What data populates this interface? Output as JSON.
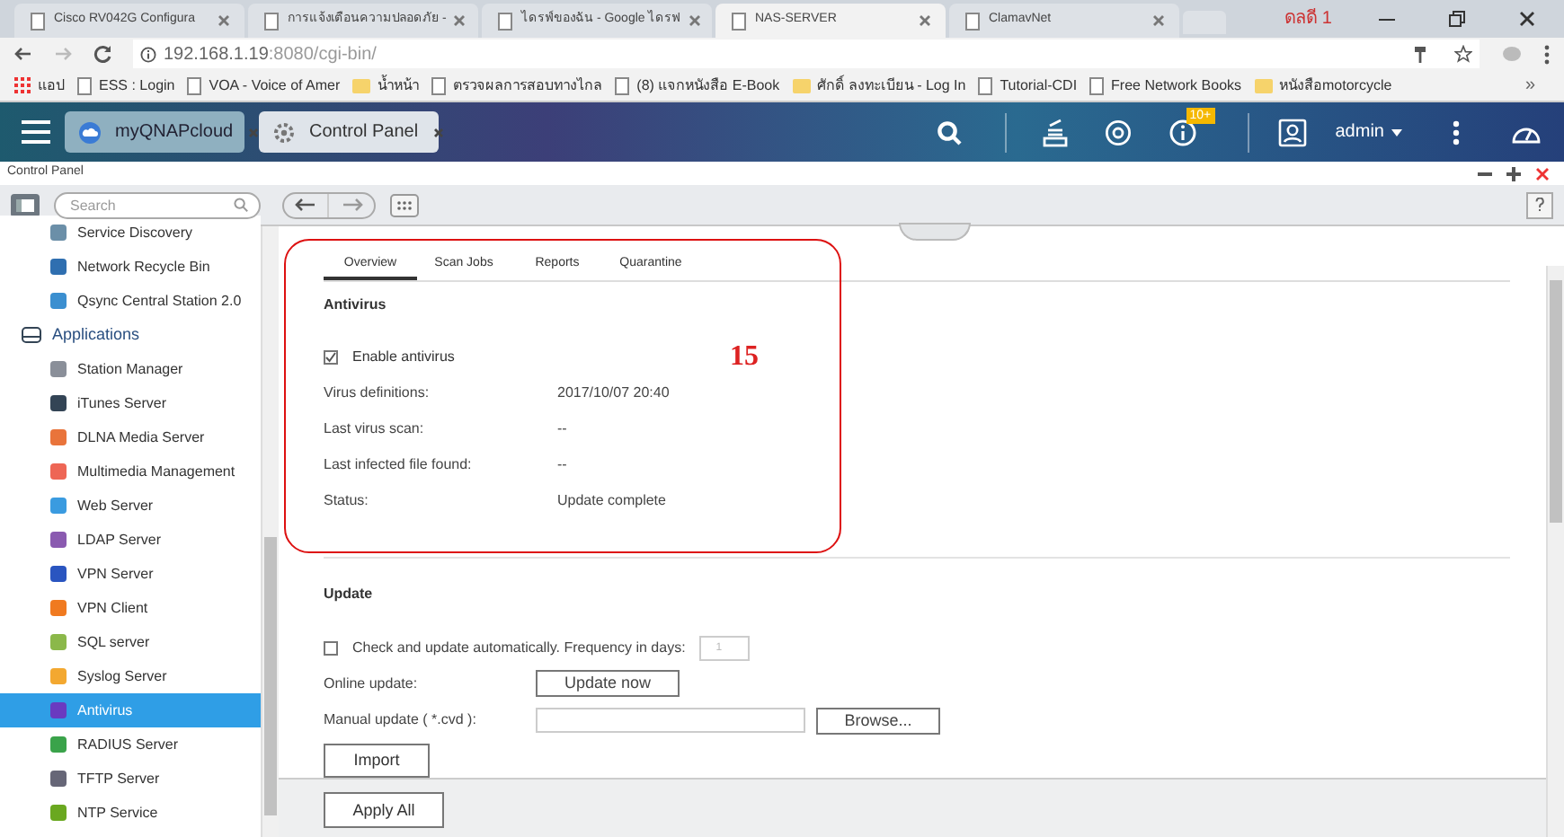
{
  "browser": {
    "tabs": [
      {
        "title": "Cisco RV042G Configura",
        "selected": false
      },
      {
        "title": "การแจ้งเตือนความปลอดภัย -",
        "selected": false
      },
      {
        "title": "ไดรฟ์ของฉัน - Google ไดรฟ",
        "selected": false
      },
      {
        "title": "NAS-SERVER",
        "selected": true
      },
      {
        "title": "ClamavNet",
        "selected": false
      }
    ],
    "profile": "ดลดี 1",
    "url_host": "192.168.1.19",
    "url_rest": ":8080/cgi-bin/",
    "bookmarks": [
      "แอป",
      "ESS : Login",
      "VOA - Voice of Amer",
      "น้ำหน้า",
      "ตรวจผลการสอบทางไกล",
      "(8) แจกหนังสือ E-Book",
      "ศักดิ์ ลงทะเบียน - Log In",
      "Tutorial-CDI",
      "Free Network Books",
      "หนังสือmotorcycle"
    ],
    "more": "»"
  },
  "qnap": {
    "tabs": [
      {
        "title": "myQNAPcloud",
        "selected": false
      },
      {
        "title": "Control Panel",
        "selected": true
      }
    ],
    "badge": "10+",
    "user": "admin"
  },
  "window": {
    "title": "Control Panel",
    "search": {
      "placeholder": "Search"
    }
  },
  "sidebar": {
    "items": [
      {
        "label": "Service Discovery",
        "kind": "item",
        "selected": false
      },
      {
        "label": "Network Recycle Bin",
        "kind": "item",
        "selected": false
      },
      {
        "label": "Qsync Central Station 2.0",
        "kind": "item",
        "selected": false
      },
      {
        "label": "Applications",
        "kind": "group",
        "selected": false
      },
      {
        "label": "Station Manager",
        "kind": "item",
        "selected": false
      },
      {
        "label": "iTunes Server",
        "kind": "item",
        "selected": false
      },
      {
        "label": "DLNA Media Server",
        "kind": "item",
        "selected": false
      },
      {
        "label": "Multimedia Management",
        "kind": "item",
        "selected": false
      },
      {
        "label": "Web Server",
        "kind": "item",
        "selected": false
      },
      {
        "label": "LDAP Server",
        "kind": "item",
        "selected": false
      },
      {
        "label": "VPN Server",
        "kind": "item",
        "selected": false
      },
      {
        "label": "VPN Client",
        "kind": "item",
        "selected": false
      },
      {
        "label": "SQL server",
        "kind": "item",
        "selected": false
      },
      {
        "label": "Syslog Server",
        "kind": "item",
        "selected": false
      },
      {
        "label": "Antivirus",
        "kind": "item",
        "selected": true
      },
      {
        "label": "RADIUS Server",
        "kind": "item",
        "selected": false
      },
      {
        "label": "TFTP Server",
        "kind": "item",
        "selected": false
      },
      {
        "label": "NTP Service",
        "kind": "item",
        "selected": false
      }
    ]
  },
  "content": {
    "tabs": [
      {
        "label": "Overview",
        "selected": true
      },
      {
        "label": "Scan Jobs",
        "selected": false
      },
      {
        "label": "Reports",
        "selected": false
      },
      {
        "label": "Quarantine",
        "selected": false
      }
    ],
    "antivirus": {
      "heading": "Antivirus",
      "enable": {
        "label": "Enable antivirus",
        "checked": true
      },
      "rows": [
        {
          "label": "Virus definitions:",
          "value": "2017/10/07 20:40"
        },
        {
          "label": "Last virus scan:",
          "value": "--"
        },
        {
          "label": "Last infected file found:",
          "value": "--"
        },
        {
          "label": "Status:",
          "value": "Update complete"
        }
      ]
    },
    "update": {
      "heading": "Update",
      "auto": {
        "label": "Check and update automatically. Frequency in days:",
        "checked": false,
        "days": "1"
      },
      "online_label": "Online update:",
      "update_button": "Update now",
      "manual_label": "Manual update ( *.cvd ):",
      "browse_button": "Browse...",
      "import_button": "Import"
    },
    "apply_button": "Apply All"
  },
  "annotation": {
    "label": "15"
  }
}
